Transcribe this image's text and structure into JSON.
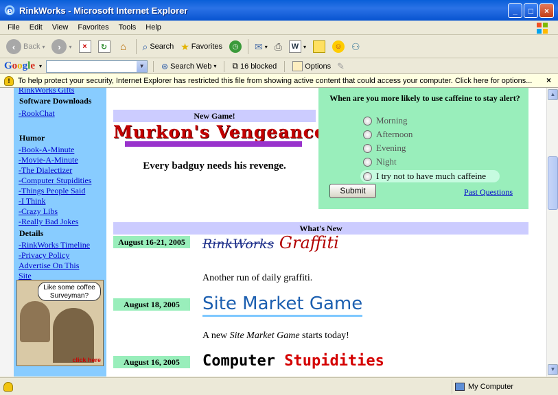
{
  "window": {
    "title": "RinkWorks - Microsoft Internet Explorer",
    "min_glyph": "_",
    "max_glyph": "□",
    "close_glyph": "×"
  },
  "menubar": [
    "File",
    "Edit",
    "View",
    "Favorites",
    "Tools",
    "Help"
  ],
  "toolbar": {
    "back": "Back",
    "search": "Search",
    "favorites": "Favorites"
  },
  "google_bar": {
    "logo": [
      "G",
      "o",
      "o",
      "g",
      "l",
      "e"
    ],
    "search_value": "",
    "search_web": "Search Web",
    "blocked": "16 blocked",
    "options": "Options"
  },
  "infobar": {
    "text": "To help protect your security, Internet Explorer has restricted this file from showing active content that could access your computer. Click here for options...",
    "close": "×"
  },
  "sidebar": {
    "cut_link": "RinkWorks Gifts",
    "software_head": "Software Downloads",
    "software_items": [
      "-RookChat"
    ],
    "humor_head": "Humor",
    "humor_items": [
      "-Book-A-Minute",
      "-Movie-A-Minute",
      "-The Dialectizer",
      "-Computer Stupidities",
      "-Things People Said",
      "-I Think",
      "-Crazy Libs",
      "-Really Bad Jokes"
    ],
    "details_head": "Details",
    "details_items": [
      "-RinkWorks Timeline",
      "-Privacy Policy",
      "Advertise On This",
      "Site"
    ],
    "ad": {
      "bubble": "Like some coffee Surveyman?",
      "click": "click here"
    }
  },
  "newgame": {
    "header": "New Game!",
    "title": "Murkon's Vengeance",
    "tagline": "Every badguy needs his revenge."
  },
  "poll": {
    "question": "When are you more likely to use caffeine to stay alert?",
    "options": [
      "Morning",
      "Afternoon",
      "Evening",
      "Night",
      "I try not to have much caffeine"
    ],
    "submit": "Submit",
    "past": "Past Questions"
  },
  "whatsnew": {
    "header": "What's New",
    "items": [
      {
        "date": "August 16-21, 2005",
        "title_a": "RinkWorks",
        "title_b": "Graffiti",
        "desc": "Another run of daily graffiti."
      },
      {
        "date": "August 18, 2005",
        "title": "Site Market Game",
        "desc_pre": "A new ",
        "desc_em": "Site Market Game",
        "desc_post": " starts today!"
      },
      {
        "date": "August 16, 2005",
        "title_a": "Computer",
        "title_b": "Stupidities"
      }
    ]
  },
  "status": {
    "zone": "My Computer"
  },
  "colors": {
    "sidebar": "#88ccff",
    "header_band": "#ccccff",
    "date_band": "#99eebb",
    "poll_bg": "#99eebb"
  }
}
